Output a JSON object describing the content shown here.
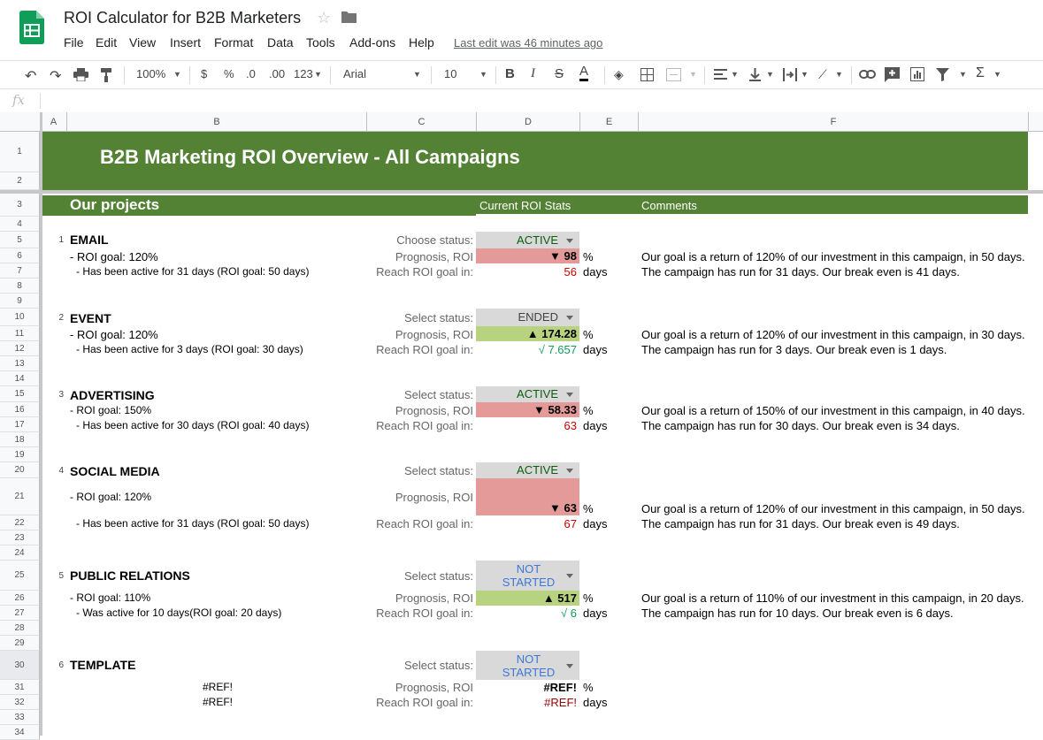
{
  "app": {
    "title": "ROI Calculator for B2B Marketers",
    "last_edit": "Last edit was 46 minutes ago"
  },
  "menu": [
    "File",
    "Edit",
    "View",
    "Insert",
    "Format",
    "Data",
    "Tools",
    "Add-ons",
    "Help"
  ],
  "toolbar": {
    "zoom": "100%",
    "currency": "$",
    "percent": "%",
    "dec_less": ".0",
    "dec_more": ".00",
    "format_more": "123",
    "font": "Arial",
    "font_size": "10",
    "bold": "B",
    "italic": "I",
    "strike": "S",
    "text_color": "A"
  },
  "formula": {
    "fx": "fx",
    "value": ""
  },
  "columns": [
    "A",
    "B",
    "C",
    "D",
    "E",
    "F"
  ],
  "rows": [
    "1",
    "2",
    "3",
    "4",
    "5",
    "6",
    "7",
    "8",
    "9",
    "10",
    "11",
    "12",
    "13",
    "14",
    "15",
    "16",
    "17",
    "18",
    "19",
    "20",
    "21",
    "22",
    "23",
    "24",
    "25",
    "26",
    "27",
    "28",
    "29",
    "30",
    "31",
    "32",
    "33",
    "34"
  ],
  "sheet": {
    "banner": "B2B Marketing ROI Overview - All Campaigns",
    "projects_header": "Our projects",
    "stats_header": "Current ROI Stats",
    "comments_header": "Comments",
    "prognosis_label": "Prognosis, ROI",
    "reach_label": "Reach ROI goal in:",
    "pct_unit": "%",
    "days_unit": "days",
    "projects": [
      {
        "num": "1",
        "name": "EMAIL",
        "status_label": "Choose status:",
        "status": "ACTIVE",
        "goal": "- ROI goal: 120%",
        "active": "- Has been active for 31 days (ROI goal: 50 days)",
        "roi": "▼ 98",
        "reach": "56",
        "comment1": "Our goal is a return of 120% of our investment in this campaign, in 50 days.",
        "comment2": "The campaign has run for 31 days. Our break even is 41 days."
      },
      {
        "num": "2",
        "name": "EVENT",
        "status_label": "Select status:",
        "status": "ENDED",
        "goal": "- ROI goal: 120%",
        "active": "- Has been active for 3 days (ROI goal: 30 days)",
        "roi": "▲ 174.28",
        "reach": "√ 7.657",
        "comment1": "Our goal is a return of 120% of our investment in this campaign, in 30 days.",
        "comment2": "The campaign has run for 3 days. Our break even is 1 days."
      },
      {
        "num": "3",
        "name": "ADVERTISING",
        "status_label": "Select status:",
        "status": "ACTIVE",
        "goal": "- ROI goal: 150%",
        "active": "- Has been active for  30 days (ROI goal: 40 days)",
        "roi": "▼ 58.33",
        "reach": "63",
        "comment1": "Our goal is a return of 150% of our investment in this campaign, in 40 days.",
        "comment2": "The campaign has run for 30 days. Our break even is 34 days."
      },
      {
        "num": "4",
        "name": "SOCIAL MEDIA",
        "status_label": "Select status:",
        "status": "ACTIVE",
        "goal": "- ROI goal: 120%",
        "active": "- Has been active for 31 days (ROI goal: 50 days)",
        "roi": "▼ 63",
        "reach": "67",
        "comment1": "Our goal is a return of 120% of our investment in this campaign, in 50 days.",
        "comment2": "The campaign has run for 31 days. Our break even is 49 days."
      },
      {
        "num": "5",
        "name": "PUBLIC RELATIONS",
        "status_label": "Select status:",
        "status": "NOT STARTED",
        "goal": "- ROI goal: 110%",
        "active": "- Was active for 10 days(ROI goal: 20 days)",
        "roi": "▲ 517",
        "reach": "√ 6",
        "comment1": "Our goal is a return of 110% of our investment in this campaign, in 20 days.",
        "comment2": "The campaign has run for 10 days. Our break even is 6 days."
      },
      {
        "num": "6",
        "name": "TEMPLATE",
        "status_label": "Select status:",
        "status": "NOT STARTED",
        "goal": "#REF!",
        "active": "#REF!",
        "roi": "#REF!",
        "reach": "#REF!"
      }
    ]
  },
  "colors": {
    "banner_green": "#548235",
    "roi_red": "#e59a9a",
    "roi_green": "#b7d37f",
    "status_grey": "#d9d9d9",
    "not_started_blue": "#3c78d8",
    "reach_good": "#0f9d58",
    "reach_bad": "#cc0000"
  }
}
